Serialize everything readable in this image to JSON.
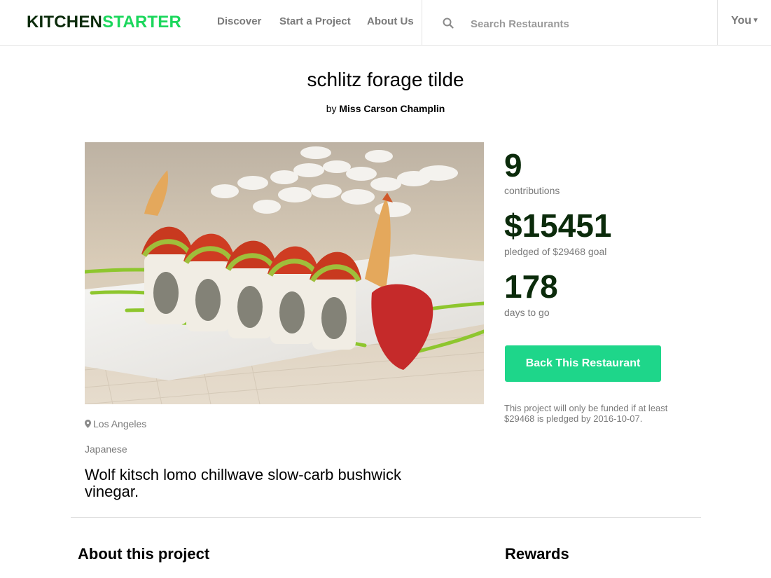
{
  "brand": {
    "part1": "KITCHEN",
    "part2": "STARTER",
    "color_dark": "#0b2b0b",
    "color_accent": "#1bd75c"
  },
  "nav": {
    "discover": "Discover",
    "start": "Start a Project",
    "about": "About Us"
  },
  "search": {
    "icon": "search-icon",
    "placeholder": "Search Restaurants"
  },
  "user_menu": {
    "label": "You",
    "icon": "caret-down-icon"
  },
  "project": {
    "title": "schlitz forage tilde",
    "by_prefix": "by",
    "author": "Miss Carson Champlin",
    "image_alt": "sushi roll",
    "location": "Los Angeles",
    "category": "Japanese",
    "blurb": "Wolf kitsch lomo chillwave slow-carb bushwick vinegar."
  },
  "stats": {
    "contributions_value": "9",
    "contributions_label": "contributions",
    "pledged_value": "$15451",
    "pledged_label": "pledged of $29468 goal",
    "days_value": "178",
    "days_label": "days to go"
  },
  "cta": {
    "label": "Back This Restaurant",
    "color": "#1ed68a"
  },
  "funding_note": "This project will only be funded if at least $29468 is pledged by 2016-10-07.",
  "sections": {
    "about": "About this project",
    "rewards": "Rewards"
  }
}
